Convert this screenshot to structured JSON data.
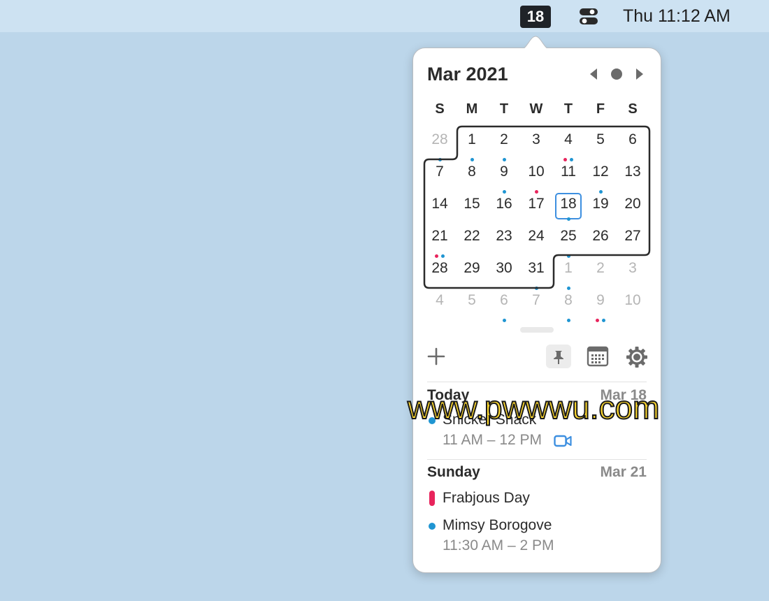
{
  "menubar": {
    "date_badge": "18",
    "clock": "Thu 11:12 AM"
  },
  "calendar": {
    "month_title": "Mar 2021",
    "weekdays": [
      "S",
      "M",
      "T",
      "W",
      "T",
      "F",
      "S"
    ],
    "weeks": [
      [
        {
          "d": "28",
          "o": true,
          "dots": [
            "blue"
          ]
        },
        {
          "d": "1",
          "dots": [
            "blue"
          ]
        },
        {
          "d": "2",
          "dots": [
            "blue"
          ]
        },
        {
          "d": "3"
        },
        {
          "d": "4",
          "dots": [
            "red",
            "blue"
          ]
        },
        {
          "d": "5"
        },
        {
          "d": "6"
        }
      ],
      [
        {
          "d": "7"
        },
        {
          "d": "8"
        },
        {
          "d": "9",
          "dots": [
            "blue"
          ]
        },
        {
          "d": "10",
          "dots": [
            "red"
          ]
        },
        {
          "d": "11"
        },
        {
          "d": "12",
          "dots": [
            "blue"
          ]
        },
        {
          "d": "13"
        }
      ],
      [
        {
          "d": "14"
        },
        {
          "d": "15"
        },
        {
          "d": "16"
        },
        {
          "d": "17"
        },
        {
          "d": "18",
          "today": true,
          "dots": [
            "blue"
          ]
        },
        {
          "d": "19"
        },
        {
          "d": "20"
        }
      ],
      [
        {
          "d": "21",
          "dots": [
            "red",
            "blue"
          ]
        },
        {
          "d": "22"
        },
        {
          "d": "23"
        },
        {
          "d": "24"
        },
        {
          "d": "25",
          "dots": [
            "blue"
          ]
        },
        {
          "d": "26"
        },
        {
          "d": "27"
        }
      ],
      [
        {
          "d": "28"
        },
        {
          "d": "29"
        },
        {
          "d": "30"
        },
        {
          "d": "31",
          "dots": [
            "blue"
          ]
        },
        {
          "d": "1",
          "o": true,
          "dots": [
            "blue"
          ]
        },
        {
          "d": "2",
          "o": true
        },
        {
          "d": "3",
          "o": true
        }
      ],
      [
        {
          "d": "4",
          "o": true
        },
        {
          "d": "5",
          "o": true
        },
        {
          "d": "6",
          "o": true,
          "dots": [
            "blue"
          ]
        },
        {
          "d": "7",
          "o": true
        },
        {
          "d": "8",
          "o": true,
          "dots": [
            "blue"
          ]
        },
        {
          "d": "9",
          "o": true,
          "dots": [
            "red",
            "blue"
          ]
        },
        {
          "d": "10",
          "o": true
        }
      ]
    ]
  },
  "colors": {
    "blue": "#1f95d2",
    "red": "#e8245c",
    "today_ring": "#3d8fe0",
    "video": "#3d8fe0"
  },
  "toolbar": {
    "add_icon": "plus-icon",
    "pin_icon": "pin-icon",
    "calendar_icon": "calendar-grid-icon",
    "settings_icon": "gear-icon"
  },
  "agenda": {
    "today": {
      "label": "Today",
      "date": "Mar 18",
      "events": [
        {
          "title": "Snicker Snack",
          "time": "11 AM – 12 PM",
          "color": "blue",
          "has_video": true
        }
      ]
    },
    "sunday": {
      "label": "Sunday",
      "date": "Mar 21",
      "events": [
        {
          "title": "Frabjous Day",
          "color": "red",
          "all_day": true
        },
        {
          "title": "Mimsy Borogove",
          "time": "11:30 AM – 2 PM",
          "color": "blue"
        }
      ]
    }
  },
  "watermark": "www.pwwwu.com"
}
